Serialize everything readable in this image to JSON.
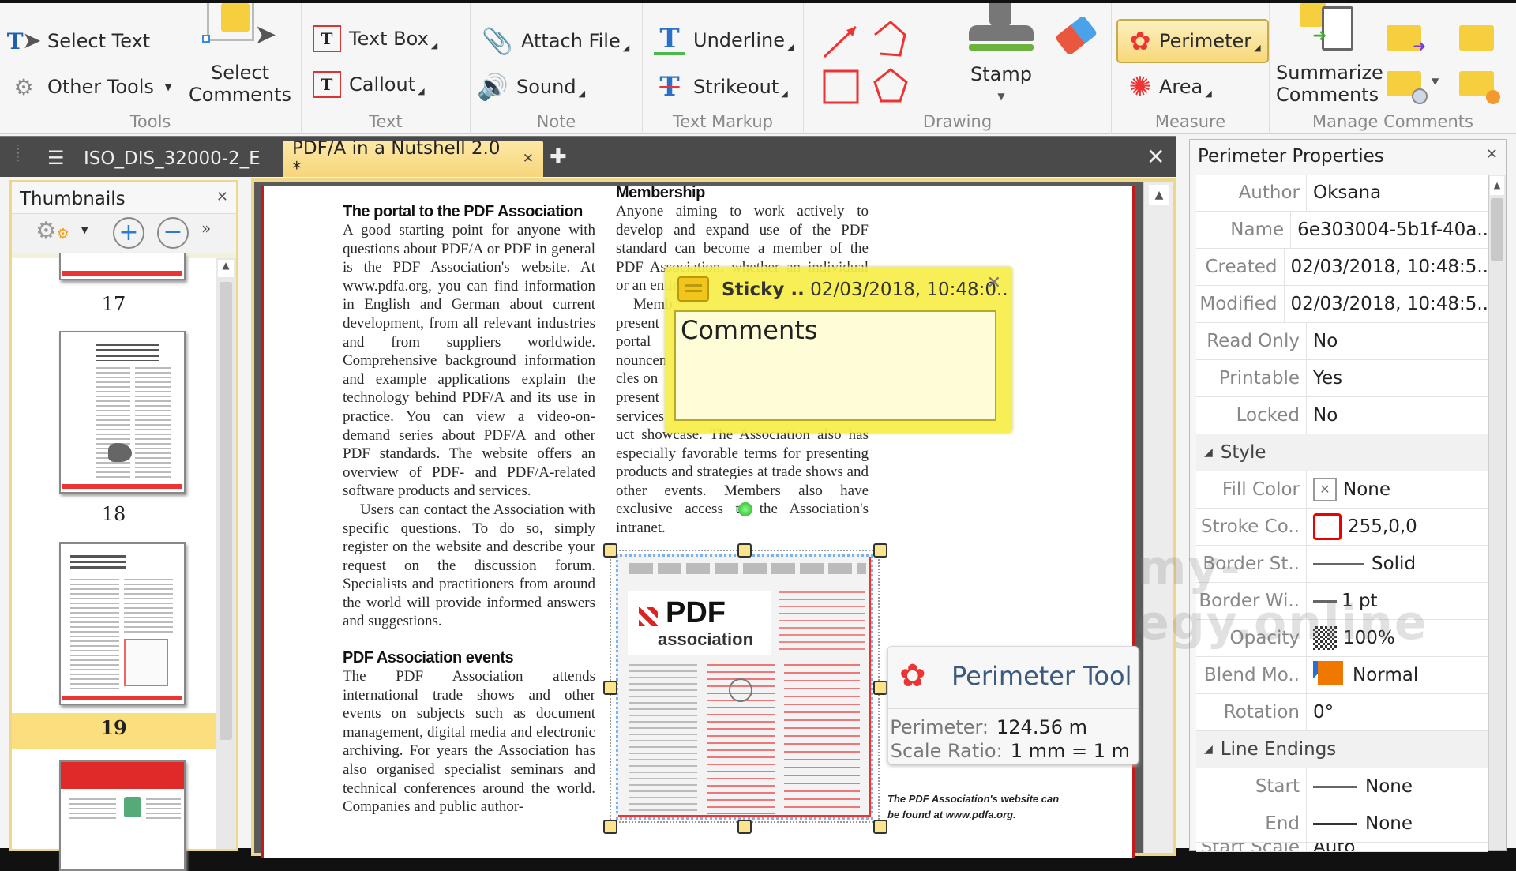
{
  "ribbon": {
    "groups": [
      {
        "label": "Tools",
        "items": [
          "Select Text",
          "Other Tools",
          "Select Comments"
        ]
      },
      {
        "label": "Text",
        "items": [
          "Text Box",
          "Callout"
        ]
      },
      {
        "label": "Note",
        "items": [
          "Attach File",
          "Sound"
        ]
      },
      {
        "label": "Text Markup",
        "items": [
          "Underline",
          "Strikeout"
        ]
      },
      {
        "label": "Drawing",
        "items": [
          "Arrow",
          "Polyline",
          "Rectangle",
          "Polygon",
          "Stamp",
          "Eraser"
        ]
      },
      {
        "label": "Measure",
        "items": [
          "Perimeter",
          "Area"
        ]
      },
      {
        "label": "Manage Comments",
        "items": [
          "Summarize Comments"
        ]
      }
    ],
    "select_text": "Select Text",
    "other_tools": "Other Tools",
    "select_comments_1": "Select",
    "select_comments_2": "Comments",
    "text_box": "Text Box",
    "callout": "Callout",
    "attach_file": "Attach File",
    "sound": "Sound",
    "underline": "Underline",
    "strikeout": "Strikeout",
    "stamp": "Stamp",
    "perimeter": "Perimeter",
    "area": "Area",
    "summarize_1": "Summarize",
    "summarize_2": "Comments",
    "labels": {
      "tools": "Tools",
      "text": "Text",
      "note": "Note",
      "text_markup": "Text Markup",
      "drawing": "Drawing",
      "measure": "Measure",
      "manage_comments": "Manage Comments"
    }
  },
  "tabs": [
    {
      "label": "ISO_DIS_32000-2_E",
      "active": false
    },
    {
      "label": "PDF/A in a Nutshell 2.0 *",
      "active": true
    }
  ],
  "thumbnails": {
    "title": "Thumbnails",
    "pages": [
      "17",
      "18",
      "19"
    ],
    "selected_page": "19"
  },
  "document": {
    "left_column": {
      "heading1": "The portal to the PDF Association",
      "para1": "A good starting point for anyone with questions about PDF/A or PDF in general is the PDF Association's website. At www.pdfa.org, you can find information in English and German about current development, from all relevant industries and from suppliers worldwide. Comprehensive background information and example applications explain the technology behind PDF/A and its use in practice. You can view a video-on-demand series about PDF/A and other PDF standards. The website offers an overview of PDF- and PDF/A-related software products and services.",
      "para2": "Users can contact the Association with specific questions. To do so, simply register on the website and describe your request on the discussion forum. Specialists and practitioners from around the world will provide informed answers and suggestions.",
      "heading2": "PDF Association events",
      "para3": "The PDF Association attends international trade shows and other events on subjects such as document management, digital media and electronic archiving. For years the Association has also organised specialist seminars and technical conferences around the world. Companies and public author-"
    },
    "right_column": {
      "heading": "Membership",
      "para1": "Anyone aiming to work actively to develop and expand use of the PDF standard can become a member of the PDF Association, whether an individual or an entire",
      "para2_lines": [
        "Memb",
        "present",
        "portal",
        "nouncen",
        "cles on",
        "present",
        "services"
      ],
      "para3": "uct showcase. The Association also has especially favorable terms for presenting products and strategies at trade shows and other events. Members also have exclusive access to the Association's intranet.",
      "caption": "The PDF Association's website can be found at www.pdfa.org."
    },
    "embedded_image": {
      "logo_top": "PDF",
      "logo_bottom": "association"
    }
  },
  "sticky_note": {
    "title": "Sticky ..",
    "timestamp": "02/03/2018, 10:48:0..",
    "content": "Comments"
  },
  "tooltip": {
    "title": "Perimeter Tool",
    "perimeter_label": "Perimeter:",
    "perimeter_value": "124.56 m",
    "scale_label": "Scale Ratio:",
    "scale_value": "1 mm = 1 m"
  },
  "properties": {
    "title": "Perimeter Properties",
    "rows": [
      {
        "key": "Author",
        "value": "Oksana"
      },
      {
        "key": "Name",
        "value": "6e303004-5b1f-40a.."
      },
      {
        "key": "Created",
        "value": "02/03/2018, 10:48:5.."
      },
      {
        "key": "Modified",
        "value": "02/03/2018, 10:48:5.."
      },
      {
        "key": "Read Only",
        "value": "No"
      },
      {
        "key": "Printable",
        "value": "Yes"
      },
      {
        "key": "Locked",
        "value": "No"
      }
    ],
    "style_section": "Style",
    "style_rows": [
      {
        "key": "Fill Color",
        "value": "None"
      },
      {
        "key": "Stroke Co..",
        "value": "255,0,0"
      },
      {
        "key": "Border St..",
        "value": "Solid"
      },
      {
        "key": "Border Wi..",
        "value": "1 pt"
      },
      {
        "key": "Opacity",
        "value": "100%"
      },
      {
        "key": "Blend Mo..",
        "value": "Normal"
      },
      {
        "key": "Rotation",
        "value": "0°"
      }
    ],
    "line_section": "Line Endings",
    "line_rows": [
      {
        "key": "Start",
        "value": "None"
      },
      {
        "key": "End",
        "value": "None"
      },
      {
        "key": "Start Scale",
        "value": "Auto"
      }
    ],
    "stroke_color": "#ff0000",
    "blend_color": "#f07800"
  },
  "watermark": "my-egy.online"
}
